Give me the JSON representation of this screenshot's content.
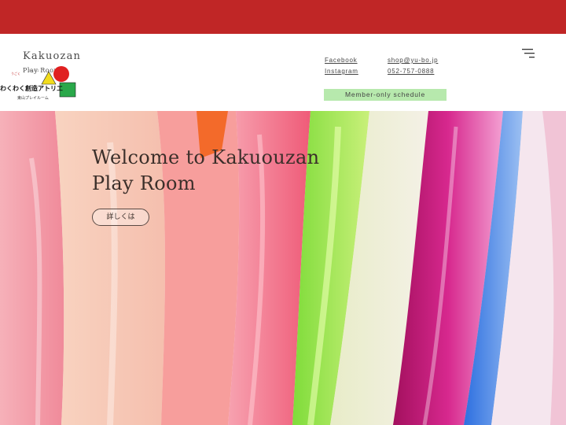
{
  "colors": {
    "top_bar": "#c02626",
    "member_button": "#b7e9ad",
    "text": "#3b2f2a"
  },
  "header": {
    "site_name": "Kakuozan",
    "site_subtitle": "Play Room",
    "links": {
      "facebook": "Facebook",
      "instagram": "Instagram",
      "email": "shop@yu-bo.jp",
      "phone": "052-757-0888"
    },
    "member_button": "Member-only schedule",
    "menu_icon": "menu-icon"
  },
  "logo": {
    "caption": "東山プレイルーム",
    "lettering": "わくわく創造アトリエ"
  },
  "hero": {
    "title": "Welcome to Kakuouzan\n Play Room",
    "button": "詳しくは"
  }
}
